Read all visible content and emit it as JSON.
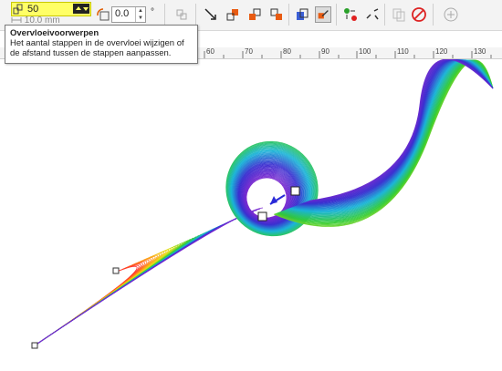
{
  "toolbar": {
    "steps_value": "50",
    "spacing_value": "10.0 mm",
    "angle_value": "0.0",
    "degree_symbol": "°",
    "icons": [
      "blend-steps-icon",
      "blend-spacing-icon",
      "rotation-icon",
      "loop-blend-icon",
      "direct-blend-icon",
      "clockwise-blend-icon",
      "counterclockwise-blend-icon",
      "object-color-acceleration-icon",
      "accelerate-sizes-icon",
      "color-blend-icon",
      "path-properties-icon",
      "more-blend-options-icon",
      "start-end-properties-icon",
      "copy-blend-icon",
      "clear-blend-icon",
      "add-icon"
    ]
  },
  "tooltip": {
    "title": "Overvloeivoorwerpen",
    "body": "Het aantal stappen in de overvloei wijzigen of de afstand tussen de stappen aanpassen."
  },
  "ruler": {
    "labels": [
      "60",
      "70",
      "80",
      "90",
      "100",
      "110",
      "120",
      "130"
    ]
  },
  "colors": {
    "blend_start": "#ff2a2a",
    "blend_mid": "#33cc33",
    "blend_end": "#3a2fd0",
    "toolbar_bg": "#f3f3f3",
    "highlight": "#ffff66"
  }
}
